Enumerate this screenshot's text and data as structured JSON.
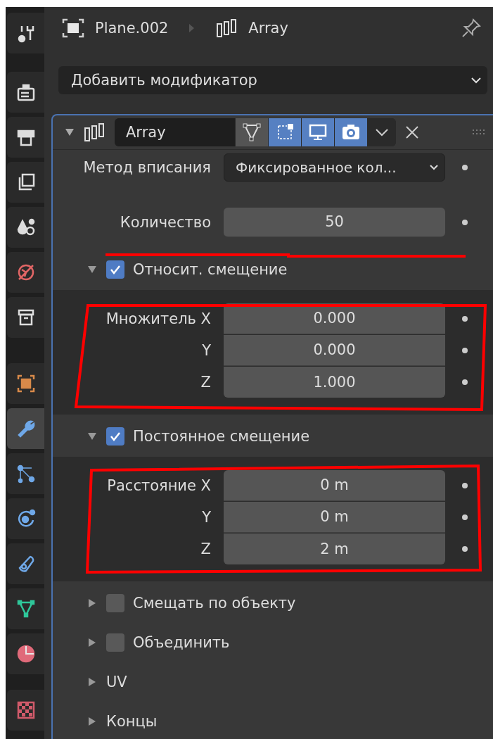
{
  "sidebar": {
    "tabs": [
      {
        "selected": false
      },
      {
        "selected": false
      },
      {
        "selected": false
      },
      {
        "selected": false
      },
      {
        "selected": false
      },
      {
        "selected": false
      },
      {
        "selected": false
      },
      {
        "selected": false
      },
      {
        "selected": true
      },
      {
        "selected": false
      },
      {
        "selected": false
      },
      {
        "selected": false
      },
      {
        "selected": false
      },
      {
        "selected": false
      },
      {
        "selected": false
      }
    ]
  },
  "header": {
    "object_name": "Plane.002",
    "modifier_name": "Array"
  },
  "add_modifier": {
    "label": "Добавить модификатор"
  },
  "modifier": {
    "expanded": true,
    "name": "Array",
    "toggles": [
      {
        "kind": "editmode",
        "selected": false
      },
      {
        "kind": "cage",
        "selected": true
      },
      {
        "kind": "viewport",
        "selected": true
      },
      {
        "kind": "render",
        "selected": true
      }
    ],
    "fit_type": {
      "label": "Метод вписания",
      "value": "Фиксированное кол..."
    },
    "count": {
      "label": "Количество",
      "value": "50"
    },
    "subpanels": [
      {
        "kind": "check",
        "label": "Относит. смещение",
        "expanded": true,
        "checked": true,
        "rows": [
          {
            "label": "Множитель X",
            "value": "0.000"
          },
          {
            "label": "Y",
            "value": "0.000"
          },
          {
            "label": "Z",
            "value": "1.000"
          }
        ]
      },
      {
        "kind": "check",
        "label": "Постоянное смещение",
        "expanded": true,
        "checked": true,
        "rows": [
          {
            "label": "Расстояние X",
            "value": "0 m"
          },
          {
            "label": "Y",
            "value": "0 m"
          },
          {
            "label": "Z",
            "value": "2 m"
          }
        ]
      },
      {
        "kind": "check",
        "label": "Смещать по объекту",
        "expanded": false,
        "checked": false
      },
      {
        "kind": "check",
        "label": "Объединить",
        "expanded": false,
        "checked": false
      },
      {
        "kind": "plain",
        "label": "UV",
        "expanded": false
      },
      {
        "kind": "plain",
        "label": "Концы",
        "expanded": false
      }
    ]
  }
}
